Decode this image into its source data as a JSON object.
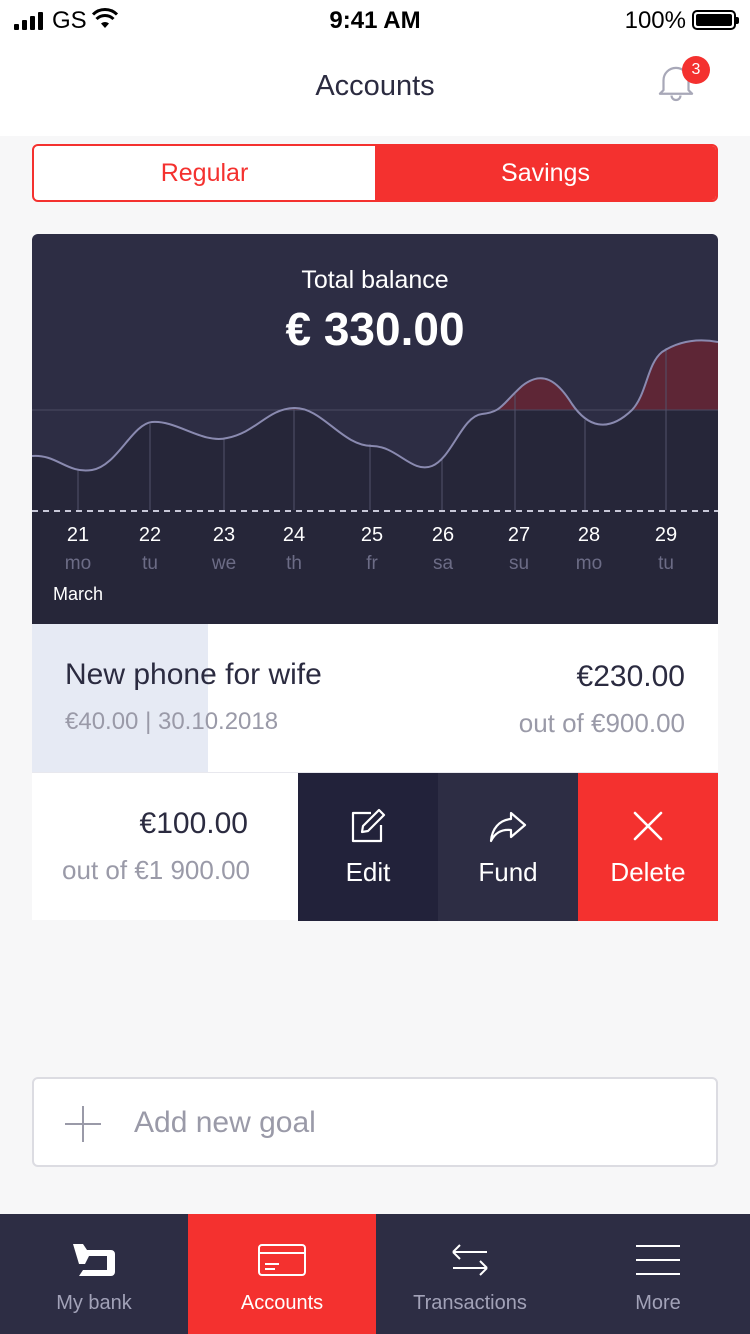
{
  "status_bar": {
    "carrier": "GS",
    "time": "9:41 AM",
    "battery": "100%"
  },
  "header": {
    "title": "Accounts",
    "notification_count": "3"
  },
  "segment": {
    "regular_label": "Regular",
    "savings_label": "Savings",
    "selected": "Savings"
  },
  "balance": {
    "label": "Total balance",
    "value": "€ 330.00",
    "month": "March",
    "days": [
      {
        "num": "21",
        "dow": "mo"
      },
      {
        "num": "22",
        "dow": "tu"
      },
      {
        "num": "23",
        "dow": "we"
      },
      {
        "num": "24",
        "dow": "th"
      },
      {
        "num": "25",
        "dow": "fr"
      },
      {
        "num": "26",
        "dow": "sa"
      },
      {
        "num": "27",
        "dow": "su"
      },
      {
        "num": "28",
        "dow": "mo"
      },
      {
        "num": "29",
        "dow": "tu"
      }
    ]
  },
  "goals": [
    {
      "name": "New phone for wife",
      "sub": "€40.00 | 30.10.2018",
      "amount": "€230.00",
      "out_of": "out of €900.00",
      "progress": 0.256
    },
    {
      "amount": "€100.00",
      "out_of": "out of €1 900.00",
      "actions": {
        "edit": "Edit",
        "fund": "Fund",
        "delete": "Delete"
      }
    }
  ],
  "add_goal": {
    "label": "Add new goal"
  },
  "tabs": [
    {
      "label": "My bank",
      "icon": "bank-logo-icon"
    },
    {
      "label": "Accounts",
      "icon": "card-icon"
    },
    {
      "label": "Transactions",
      "icon": "transfer-arrows-icon"
    },
    {
      "label": "More",
      "icon": "menu-icon"
    }
  ],
  "colors": {
    "accent": "#f4312f",
    "dark": "#2d2d44",
    "darker": "#22223a"
  }
}
